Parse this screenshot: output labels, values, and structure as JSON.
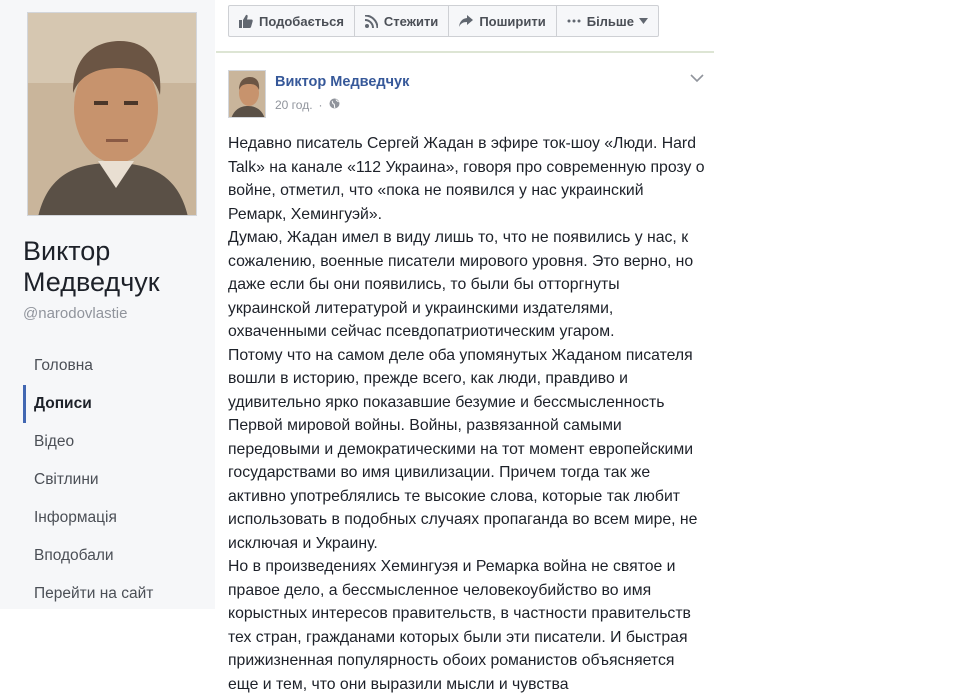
{
  "sidebar": {
    "page_name": "Виктор Медведчук",
    "handle": "@narodovlastie",
    "nav": [
      {
        "label": "Головна"
      },
      {
        "label": "Дописи"
      },
      {
        "label": "Відео"
      },
      {
        "label": "Світлини"
      },
      {
        "label": "Інформація"
      },
      {
        "label": "Вподобали"
      },
      {
        "label": "Перейти на сайт"
      }
    ]
  },
  "actions": {
    "like": "Подобається",
    "follow": "Стежити",
    "share": "Поширити",
    "more": "Більше"
  },
  "post": {
    "author": "Виктор Медведчук",
    "time": "20 год.",
    "paragraphs": [
      "Недавно писатель Сергей Жадан в эфире ток-шоу «Люди. Hard Talk» на канале «112 Украина», говоря про современную прозу о войне, отметил, что «пока не появился у нас украинский Ремарк, Хемингуэй».",
      "Думаю, Жадан имел в виду лишь то, что не появились у нас, к сожалению, военные писатели мирового уровня. Это верно, но даже если бы они появились, то были бы отторгнуты украинской литературой и украинскими издателями, охваченными сейчас псевдопатриотическим угаром.",
      "Потому что на самом деле оба упомянутых Жаданом писателя вошли в историю, прежде всего, как люди, правдиво и удивительно ярко показавшие безумие и бессмысленность Первой мировой войны. Войны, развязанной самыми передовыми и демократическими на тот момент европейскими государствами во имя цивилизации. Причем тогда так же активно употреблялись те высокие слова, которые так любит использовать в подобных случаях пропаганда во всем мире, не исключая и Украину.",
      "Но в произведениях Хемингуэя и Ремарка война не святое и правое дело, а бессмысленное человекоубийство во имя корыстных интересов правительств, в частности правительств тех стран, гражданами которых были эти писатели. И быстрая прижизненная популярность обоих романистов объясняется еще и тем, что они выразили мысли и чувства"
    ]
  },
  "colors": {
    "link": "#365899",
    "accent": "#4267b2",
    "sidebar_bg": "#f6f7f9"
  }
}
